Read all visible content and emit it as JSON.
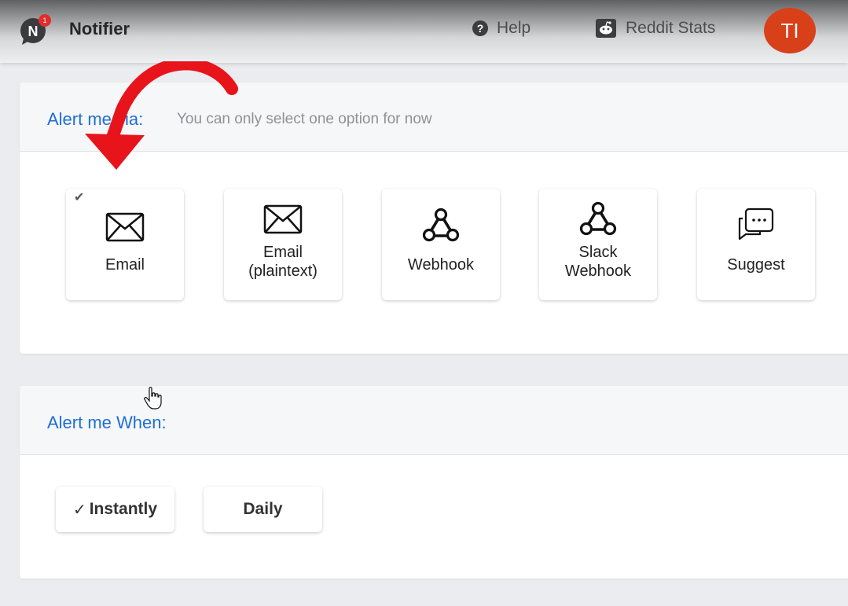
{
  "header": {
    "app_name": "Notifier",
    "logo_letter": "N",
    "notification_count": "1",
    "help_label": "Help",
    "reddit_stats_label": "Reddit Stats",
    "avatar_initials": "TI"
  },
  "alert_via": {
    "title": "Alert me via:",
    "hint": "You can only select one option for now",
    "options": [
      {
        "label": "Email",
        "icon": "envelope-icon",
        "selected": true
      },
      {
        "label": "Email\n(plaintext)",
        "icon": "envelope-icon",
        "selected": false
      },
      {
        "label": "Webhook",
        "icon": "webhook-icon",
        "selected": false
      },
      {
        "label": "Slack\nWebhook",
        "icon": "webhook-icon",
        "selected": false
      },
      {
        "label": "Suggest",
        "icon": "chat-bubble-icon",
        "selected": false
      }
    ]
  },
  "alert_when": {
    "title": "Alert me When:",
    "options": [
      {
        "label": "Instantly",
        "selected": true
      },
      {
        "label": "Daily",
        "selected": false
      }
    ]
  },
  "colors": {
    "accent_blue": "#1f6ed4",
    "avatar_bg": "#d8401a",
    "annotation_arrow": "#e8141b"
  }
}
